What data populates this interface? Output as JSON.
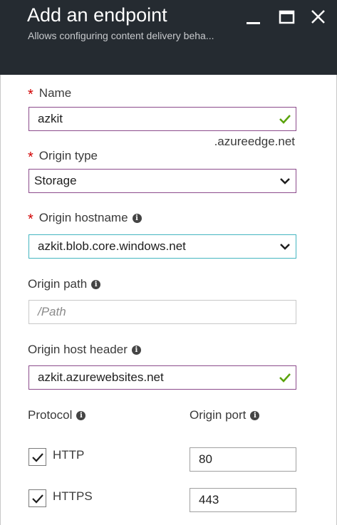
{
  "header": {
    "title": "Add an endpoint",
    "subtitle": "Allows configuring content delivery beha..."
  },
  "form": {
    "required_marker": "*",
    "info_glyph": "i",
    "name": {
      "label": "Name",
      "value": "azkit",
      "suffix": ".azureedge.net"
    },
    "origin_type": {
      "label": "Origin type",
      "value": "Storage"
    },
    "origin_hostname": {
      "label": "Origin hostname",
      "value": "azkit.blob.core.windows.net"
    },
    "origin_path": {
      "label": "Origin path",
      "placeholder": "/Path"
    },
    "origin_host_header": {
      "label": "Origin host header",
      "value": "azkit.azurewebsites.net"
    },
    "protocol": {
      "label": "Protocol",
      "http": {
        "label": "HTTP",
        "checked": true
      },
      "https": {
        "label": "HTTPS",
        "checked": true
      }
    },
    "origin_port": {
      "label": "Origin port",
      "http_port": "80",
      "https_port": "443"
    }
  },
  "colors": {
    "header_bg": "#252b31",
    "required": "#d10000",
    "valid_check": "#5aa30b",
    "focus_border": "#45b5c0",
    "field_border": "#8c4b8c"
  }
}
